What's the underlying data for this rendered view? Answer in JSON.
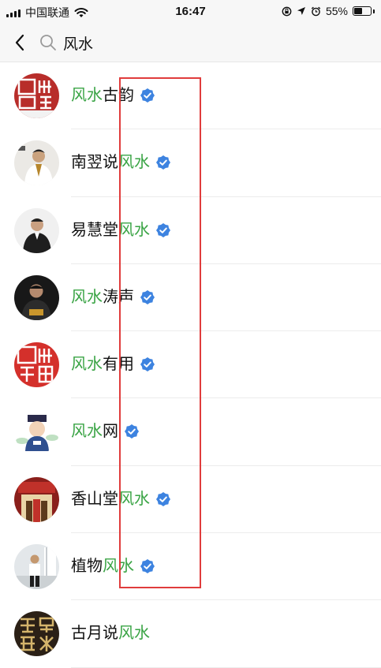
{
  "status_bar": {
    "carrier": "中国联通",
    "time": "16:47",
    "battery_percent": "55%",
    "battery_level": 0.55
  },
  "search": {
    "query": "风水"
  },
  "results": [
    {
      "parts": [
        {
          "text": "风水",
          "hl": true
        },
        {
          "text": "古韵",
          "hl": false
        }
      ],
      "verified": true
    },
    {
      "parts": [
        {
          "text": "南翌说",
          "hl": false
        },
        {
          "text": "风水",
          "hl": true
        }
      ],
      "verified": true
    },
    {
      "parts": [
        {
          "text": "易慧堂",
          "hl": false
        },
        {
          "text": "风水",
          "hl": true
        }
      ],
      "verified": true
    },
    {
      "parts": [
        {
          "text": "风水",
          "hl": true
        },
        {
          "text": "涛声",
          "hl": false
        }
      ],
      "verified": true
    },
    {
      "parts": [
        {
          "text": "风水",
          "hl": true
        },
        {
          "text": "有用",
          "hl": false
        }
      ],
      "verified": true
    },
    {
      "parts": [
        {
          "text": "风水",
          "hl": true
        },
        {
          "text": "网",
          "hl": false
        }
      ],
      "verified": true
    },
    {
      "parts": [
        {
          "text": "香山堂",
          "hl": false
        },
        {
          "text": "风水",
          "hl": true
        }
      ],
      "verified": true
    },
    {
      "parts": [
        {
          "text": "植物",
          "hl": false
        },
        {
          "text": "风水",
          "hl": true
        }
      ],
      "verified": true
    },
    {
      "parts": [
        {
          "text": "古月说",
          "hl": false
        },
        {
          "text": "风水",
          "hl": true
        }
      ],
      "verified": false
    }
  ],
  "colors": {
    "highlight": "#3aa445",
    "verified": "#3d83e0",
    "annotation": "#e03c3c"
  }
}
